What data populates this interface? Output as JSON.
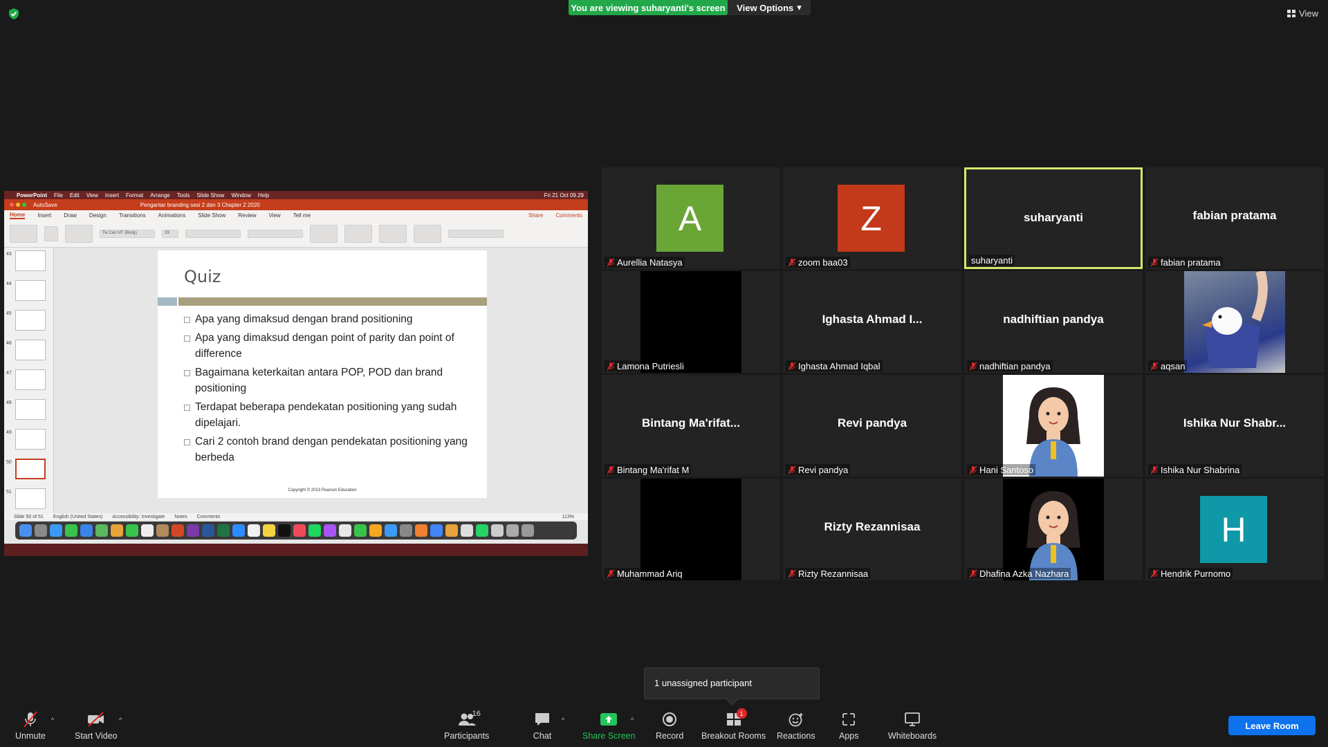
{
  "banner": {
    "viewing_text": "You are viewing suharyanti's screen",
    "view_options": "View Options"
  },
  "top_right": {
    "view_label": "View"
  },
  "shared_screen": {
    "menu": {
      "app": "PowerPoint",
      "items": [
        "File",
        "Edit",
        "View",
        "Insert",
        "Format",
        "Arrange",
        "Tools",
        "Slide Show",
        "Window",
        "Help"
      ],
      "clock": "Fri 21 Oct 09.29"
    },
    "title_bar": {
      "autosave": "AutoSave",
      "document": "Pengantar branding sesi 2 dan 3 Chapter 2 2020"
    },
    "ribbon_tabs": [
      "Home",
      "Insert",
      "Draw",
      "Design",
      "Transitions",
      "Animations",
      "Slide Show",
      "Review",
      "View",
      "Tell me"
    ],
    "share_label": "Share",
    "comments_label": "Comments",
    "font_name": "Tw Cen MT (Body)",
    "font_size": "29",
    "thumb_numbers": [
      "43",
      "44",
      "45",
      "46",
      "47",
      "48",
      "49",
      "50",
      "51"
    ],
    "slide": {
      "title": "Quiz",
      "bullets": [
        "Apa yang dimaksud dengan brand positioning",
        "Apa yang dimaksud dengan point of parity dan point of difference",
        "Bagaimana keterkaitan antara POP, POD dan brand positioning",
        "Terdapat beberapa pendekatan  positioning yang sudah dipelajari.",
        "Cari  2 contoh brand dengan pendekatan positioning yang berbeda"
      ],
      "copyright": "Copyright © 2013  Pearson Education"
    },
    "status": {
      "slide_count": "Slide 50 of 51",
      "language": "English (United States)",
      "accessibility": "Accessibility: Investigate",
      "notes": "Notes",
      "comments": "Comments",
      "zoom": "113%"
    }
  },
  "participants": [
    {
      "display": "avatar",
      "initial": "A",
      "color": "#6aa636",
      "label": "Aurellia Natasya"
    },
    {
      "display": "avatar",
      "initial": "Z",
      "color": "#c4391a",
      "label": "zoom baa03"
    },
    {
      "display": "name",
      "center": "suharyanti",
      "label": "suharyanti",
      "active": true
    },
    {
      "display": "name",
      "center": "fabian pratama",
      "label": "fabian pratama"
    },
    {
      "display": "video",
      "label": "Lamona Putriesli"
    },
    {
      "display": "name",
      "center": "Ighasta Ahmad I...",
      "label": "Ighasta Ahmad Iqbal"
    },
    {
      "display": "name",
      "center": "nadhiftian pandya",
      "label": "nadhiftian pandya"
    },
    {
      "display": "video",
      "label": "aqsan"
    },
    {
      "display": "name",
      "center": "Bintang  Ma'rifat...",
      "label": "Bintang Ma'rifat M"
    },
    {
      "display": "name",
      "center": "Revi pandya",
      "label": "Revi pandya"
    },
    {
      "display": "video",
      "label": "Hani Santoso"
    },
    {
      "display": "name",
      "center": "Ishika  Nur Shabr...",
      "label": "Ishika Nur Shabrina"
    },
    {
      "display": "video",
      "label": "Muhammad Ariq"
    },
    {
      "display": "name",
      "center": "Rizty Rezannisaa",
      "label": "Rizty Rezannisaa"
    },
    {
      "display": "video",
      "label": "Dhafina Azka Nazhara"
    },
    {
      "display": "avatar",
      "initial": "H",
      "color": "#0e98a8",
      "label": "Hendrik Purnomo"
    }
  ],
  "tooltip": {
    "text": "1 unassigned participant"
  },
  "toolbar": {
    "unmute": "Unmute",
    "start_video": "Start Video",
    "participants": "Participants",
    "participants_count": "16",
    "chat": "Chat",
    "share_screen": "Share Screen",
    "record": "Record",
    "breakout_rooms": "Breakout Rooms",
    "breakout_badge": "1",
    "reactions": "Reactions",
    "apps": "Apps",
    "whiteboards": "Whiteboards",
    "leave": "Leave Room"
  }
}
